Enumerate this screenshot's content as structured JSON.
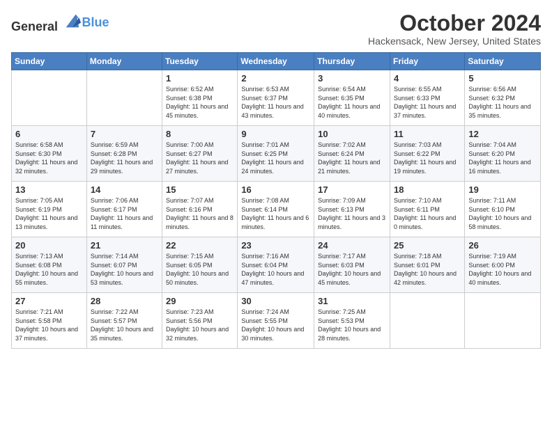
{
  "logo": {
    "general": "General",
    "blue": "Blue"
  },
  "header": {
    "month": "October 2024",
    "location": "Hackensack, New Jersey, United States"
  },
  "weekdays": [
    "Sunday",
    "Monday",
    "Tuesday",
    "Wednesday",
    "Thursday",
    "Friday",
    "Saturday"
  ],
  "weeks": [
    [
      {
        "day": "",
        "info": ""
      },
      {
        "day": "",
        "info": ""
      },
      {
        "day": "1",
        "info": "Sunrise: 6:52 AM\nSunset: 6:38 PM\nDaylight: 11 hours and 45 minutes."
      },
      {
        "day": "2",
        "info": "Sunrise: 6:53 AM\nSunset: 6:37 PM\nDaylight: 11 hours and 43 minutes."
      },
      {
        "day": "3",
        "info": "Sunrise: 6:54 AM\nSunset: 6:35 PM\nDaylight: 11 hours and 40 minutes."
      },
      {
        "day": "4",
        "info": "Sunrise: 6:55 AM\nSunset: 6:33 PM\nDaylight: 11 hours and 37 minutes."
      },
      {
        "day": "5",
        "info": "Sunrise: 6:56 AM\nSunset: 6:32 PM\nDaylight: 11 hours and 35 minutes."
      }
    ],
    [
      {
        "day": "6",
        "info": "Sunrise: 6:58 AM\nSunset: 6:30 PM\nDaylight: 11 hours and 32 minutes."
      },
      {
        "day": "7",
        "info": "Sunrise: 6:59 AM\nSunset: 6:28 PM\nDaylight: 11 hours and 29 minutes."
      },
      {
        "day": "8",
        "info": "Sunrise: 7:00 AM\nSunset: 6:27 PM\nDaylight: 11 hours and 27 minutes."
      },
      {
        "day": "9",
        "info": "Sunrise: 7:01 AM\nSunset: 6:25 PM\nDaylight: 11 hours and 24 minutes."
      },
      {
        "day": "10",
        "info": "Sunrise: 7:02 AM\nSunset: 6:24 PM\nDaylight: 11 hours and 21 minutes."
      },
      {
        "day": "11",
        "info": "Sunrise: 7:03 AM\nSunset: 6:22 PM\nDaylight: 11 hours and 19 minutes."
      },
      {
        "day": "12",
        "info": "Sunrise: 7:04 AM\nSunset: 6:20 PM\nDaylight: 11 hours and 16 minutes."
      }
    ],
    [
      {
        "day": "13",
        "info": "Sunrise: 7:05 AM\nSunset: 6:19 PM\nDaylight: 11 hours and 13 minutes."
      },
      {
        "day": "14",
        "info": "Sunrise: 7:06 AM\nSunset: 6:17 PM\nDaylight: 11 hours and 11 minutes."
      },
      {
        "day": "15",
        "info": "Sunrise: 7:07 AM\nSunset: 6:16 PM\nDaylight: 11 hours and 8 minutes."
      },
      {
        "day": "16",
        "info": "Sunrise: 7:08 AM\nSunset: 6:14 PM\nDaylight: 11 hours and 6 minutes."
      },
      {
        "day": "17",
        "info": "Sunrise: 7:09 AM\nSunset: 6:13 PM\nDaylight: 11 hours and 3 minutes."
      },
      {
        "day": "18",
        "info": "Sunrise: 7:10 AM\nSunset: 6:11 PM\nDaylight: 11 hours and 0 minutes."
      },
      {
        "day": "19",
        "info": "Sunrise: 7:11 AM\nSunset: 6:10 PM\nDaylight: 10 hours and 58 minutes."
      }
    ],
    [
      {
        "day": "20",
        "info": "Sunrise: 7:13 AM\nSunset: 6:08 PM\nDaylight: 10 hours and 55 minutes."
      },
      {
        "day": "21",
        "info": "Sunrise: 7:14 AM\nSunset: 6:07 PM\nDaylight: 10 hours and 53 minutes."
      },
      {
        "day": "22",
        "info": "Sunrise: 7:15 AM\nSunset: 6:05 PM\nDaylight: 10 hours and 50 minutes."
      },
      {
        "day": "23",
        "info": "Sunrise: 7:16 AM\nSunset: 6:04 PM\nDaylight: 10 hours and 47 minutes."
      },
      {
        "day": "24",
        "info": "Sunrise: 7:17 AM\nSunset: 6:03 PM\nDaylight: 10 hours and 45 minutes."
      },
      {
        "day": "25",
        "info": "Sunrise: 7:18 AM\nSunset: 6:01 PM\nDaylight: 10 hours and 42 minutes."
      },
      {
        "day": "26",
        "info": "Sunrise: 7:19 AM\nSunset: 6:00 PM\nDaylight: 10 hours and 40 minutes."
      }
    ],
    [
      {
        "day": "27",
        "info": "Sunrise: 7:21 AM\nSunset: 5:58 PM\nDaylight: 10 hours and 37 minutes."
      },
      {
        "day": "28",
        "info": "Sunrise: 7:22 AM\nSunset: 5:57 PM\nDaylight: 10 hours and 35 minutes."
      },
      {
        "day": "29",
        "info": "Sunrise: 7:23 AM\nSunset: 5:56 PM\nDaylight: 10 hours and 32 minutes."
      },
      {
        "day": "30",
        "info": "Sunrise: 7:24 AM\nSunset: 5:55 PM\nDaylight: 10 hours and 30 minutes."
      },
      {
        "day": "31",
        "info": "Sunrise: 7:25 AM\nSunset: 5:53 PM\nDaylight: 10 hours and 28 minutes."
      },
      {
        "day": "",
        "info": ""
      },
      {
        "day": "",
        "info": ""
      }
    ]
  ],
  "colors": {
    "header_bg": "#4a7fc1",
    "accent": "#4a90d9"
  }
}
